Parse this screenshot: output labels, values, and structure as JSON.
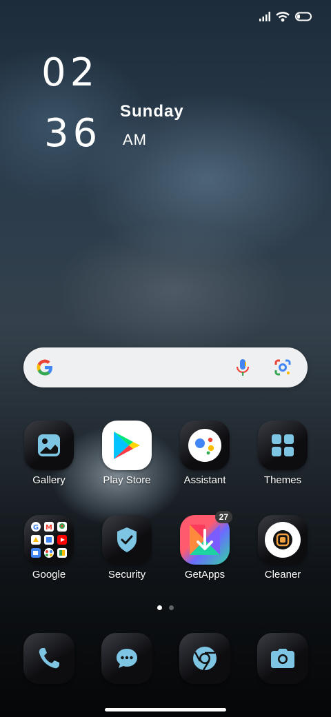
{
  "status_bar": {
    "signal_icon": "signal-icon",
    "wifi_icon": "wifi-icon",
    "battery_icon": "battery-icon"
  },
  "clock": {
    "hour": "02",
    "minute": "36",
    "day": "Sunday",
    "ampm": "AM"
  },
  "search_bar": {
    "google_icon": "google-g-icon",
    "mic_icon": "mic-icon",
    "lens_icon": "lens-icon"
  },
  "apps_row1": [
    {
      "label": "Gallery",
      "icon": "gallery-icon"
    },
    {
      "label": "Play Store",
      "icon": "play-store-icon"
    },
    {
      "label": "Assistant",
      "icon": "assistant-icon"
    },
    {
      "label": "Themes",
      "icon": "themes-icon"
    }
  ],
  "apps_row2": [
    {
      "label": "Google",
      "icon": "google-folder-icon"
    },
    {
      "label": "Security",
      "icon": "security-icon"
    },
    {
      "label": "GetApps",
      "icon": "getapps-icon",
      "badge": "27"
    },
    {
      "label": "Cleaner",
      "icon": "cleaner-icon"
    }
  ],
  "dock": [
    {
      "icon": "phone-icon"
    },
    {
      "icon": "messages-icon"
    },
    {
      "icon": "chrome-icon"
    },
    {
      "icon": "camera-icon"
    }
  ],
  "page_indicator": {
    "pages": 2,
    "current": 1
  },
  "colors": {
    "accent": "#7ec4e3",
    "search_bg": "#eff0f1"
  }
}
